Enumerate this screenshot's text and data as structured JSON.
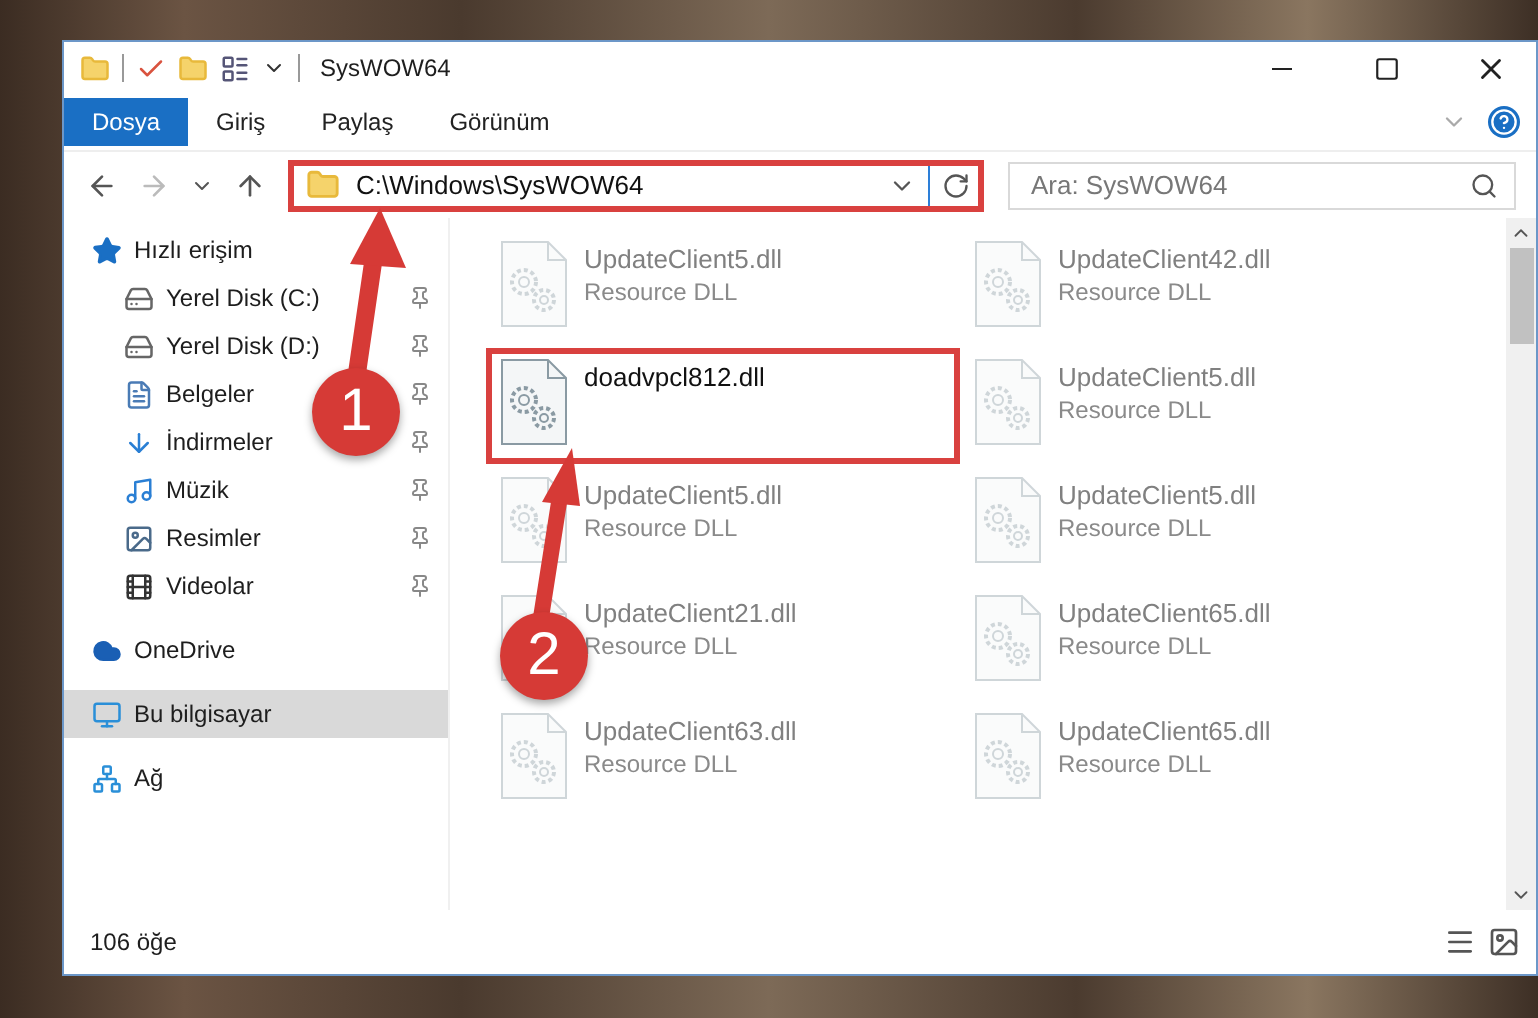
{
  "window": {
    "title": "SysWOW64"
  },
  "ribbon_tabs": [
    {
      "label": "Dosya",
      "selected": true
    },
    {
      "label": "Giriş",
      "selected": false
    },
    {
      "label": "Paylaş",
      "selected": false
    },
    {
      "label": "Görünüm",
      "selected": false
    }
  ],
  "address_bar": {
    "value": "C:\\Windows\\SysWOW64",
    "highlighted": true
  },
  "search": {
    "placeholder": "Ara: SysWOW64"
  },
  "navigation": [
    {
      "label": "Hızlı erişim",
      "kind": "star",
      "selected": false,
      "children": [
        {
          "label": "Yerel Disk (C:)",
          "kind": "drive",
          "pinned": true,
          "selected": false
        },
        {
          "label": "Yerel Disk (D:)",
          "kind": "drive",
          "pinned": true,
          "selected": false
        },
        {
          "label": "Belgeler",
          "kind": "document",
          "pinned": true,
          "selected": false
        },
        {
          "label": "İndirmeler",
          "kind": "download",
          "pinned": true,
          "selected": false
        },
        {
          "label": "Müzik",
          "kind": "music",
          "pinned": true,
          "selected": false
        },
        {
          "label": "Resimler",
          "kind": "picture",
          "pinned": true,
          "selected": false
        },
        {
          "label": "Videolar",
          "kind": "video",
          "pinned": true,
          "selected": false
        }
      ]
    },
    {
      "label": "OneDrive",
      "kind": "cloud",
      "selected": false
    },
    {
      "label": "Bu bilgisayar",
      "kind": "computer",
      "selected": true
    },
    {
      "label": "Ağ",
      "kind": "network",
      "selected": false
    }
  ],
  "files": [
    {
      "name": "UpdateClient5.dll",
      "type": "Resource DLL",
      "blurred": true,
      "highlighted": false
    },
    {
      "name": "UpdateClient42.dll",
      "type": "Resource DLL",
      "blurred": true,
      "highlighted": false
    },
    {
      "name": "doadvpcl812.dll",
      "blurred": false,
      "highlighted": true
    },
    {
      "name": "UpdateClient5.dll",
      "type": "Resource DLL",
      "blurred": true,
      "highlighted": false
    },
    {
      "name": "UpdateClient5.dll",
      "type": "Resource DLL",
      "blurred": true,
      "highlighted": false
    },
    {
      "name": "UpdateClient5.dll",
      "type": "Resource DLL",
      "blurred": true,
      "highlighted": false
    },
    {
      "name": "UpdateClient21.dll",
      "type": "Resource DLL",
      "blurred": true,
      "highlighted": false
    },
    {
      "name": "UpdateClient65.dll",
      "type": "Resource DLL",
      "blurred": true,
      "highlighted": false
    },
    {
      "name": "UpdateClient63.dll",
      "type": "Resource DLL",
      "blurred": true,
      "highlighted": false
    },
    {
      "name": "UpdateClient65.dll",
      "type": "Resource DLL",
      "blurred": true,
      "highlighted": false
    }
  ],
  "callouts": [
    {
      "label": "1"
    },
    {
      "label": "2"
    }
  ],
  "status_bar": {
    "item_count": "106 öğe"
  }
}
